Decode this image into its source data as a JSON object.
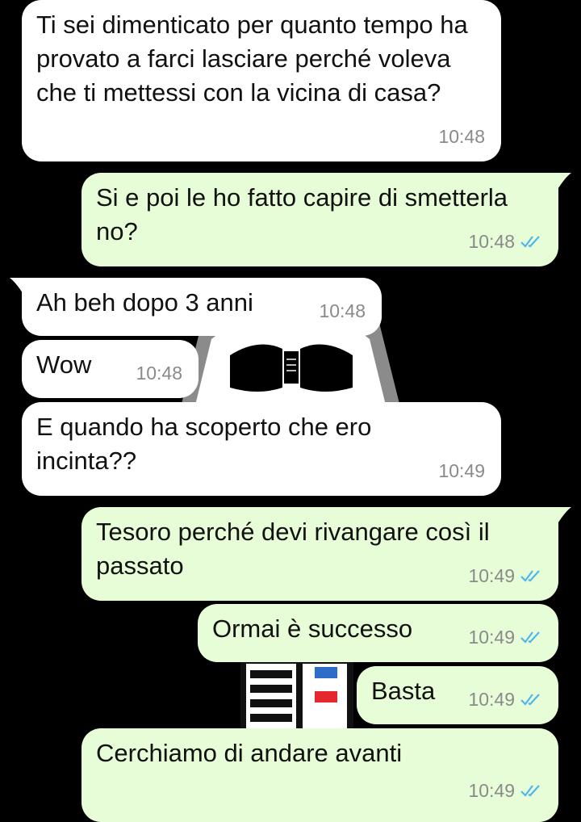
{
  "chat": {
    "messages": [
      {
        "dir": "in",
        "text": "Ti sei dimenticato per quanto tempo ha provato a farci lasciare perché voleva che ti mettessi con la vicina di casa?",
        "time": "10:48"
      },
      {
        "dir": "out",
        "text": "Si e poi le ho fatto capire di smetterla no?",
        "time": "10:48",
        "status": "read"
      },
      {
        "dir": "in",
        "text": "Ah beh dopo 3 anni",
        "time": "10:48"
      },
      {
        "dir": "in",
        "text": "Wow",
        "time": "10:48"
      },
      {
        "dir": "in",
        "text": "E quando ha scoperto che ero incinta??",
        "time": "10:49"
      },
      {
        "dir": "out",
        "text": "Tesoro perché devi rivangare così il passato",
        "time": "10:49",
        "status": "read"
      },
      {
        "dir": "out",
        "text": "Ormai è successo",
        "time": "10:49",
        "status": "read"
      },
      {
        "dir": "out",
        "text": "Basta",
        "time": "10:49",
        "status": "read"
      },
      {
        "dir": "out",
        "text": "Cerchiamo di andare avanti",
        "time": "10:49",
        "status": "read"
      }
    ]
  },
  "colors": {
    "background": "#000000",
    "incoming_bubble": "#ffffff",
    "outgoing_bubble": "#e7fdd7",
    "read_ticks": "#4fb6ec",
    "time_text": "#8a8a8a"
  },
  "icons": {
    "read_status": "double-check-icon",
    "wallpaper": "darth-vader-wallpaper"
  }
}
